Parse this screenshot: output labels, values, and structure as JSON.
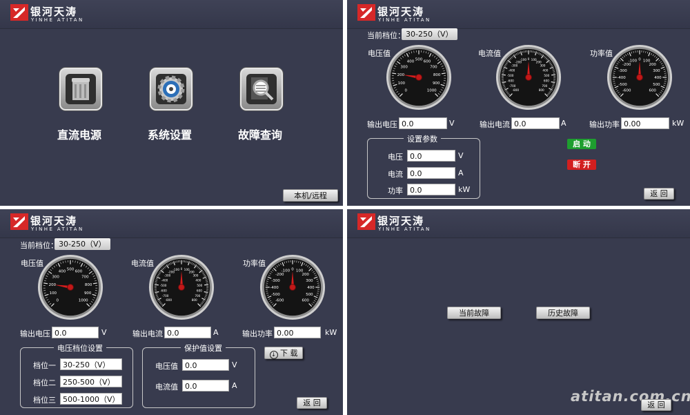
{
  "brand": {
    "name_cn": "银河天涛",
    "name_en": "YINHE ATITAN",
    "logo_color": "#d62828"
  },
  "colors": {
    "panel_bg": "#383b4e",
    "start_button": "#1e9e2f",
    "stop_button": "#d21f1f"
  },
  "menu": {
    "items": [
      {
        "label": "直流电源",
        "icon": "power-supply-icon"
      },
      {
        "label": "系统设置",
        "icon": "gear-icon"
      },
      {
        "label": "故障查询",
        "icon": "fault-search-icon"
      }
    ],
    "local_remote_label": "本机/远程"
  },
  "monitor": {
    "current_range_label": "当前档位：",
    "current_range_value": "30-250（V）",
    "voltage_gauge": {
      "title": "电压值",
      "ticks": [
        "0",
        "100",
        "200",
        "300",
        "400",
        "500",
        "600",
        "700",
        "800",
        "900",
        "1000"
      ],
      "value": 200
    },
    "current_gauge": {
      "title": "电流值",
      "ticks": [
        "-800",
        "-700",
        "-600",
        "-500",
        "-400",
        "-300",
        "-200",
        "-100",
        "0",
        "100",
        "200",
        "300",
        "400",
        "500",
        "600",
        "700",
        "800"
      ],
      "value": 0
    },
    "power_gauge": {
      "title": "功率值",
      "ticks": [
        "-600",
        "-500",
        "-400",
        "-300",
        "-200",
        "-100",
        "0",
        "100",
        "200",
        "300",
        "400",
        "500",
        "600"
      ],
      "value": 0
    },
    "output_voltage": {
      "label": "输出电压",
      "value": "0.0",
      "unit": "V"
    },
    "output_current": {
      "label": "输出电流",
      "value": "0.0",
      "unit": "A"
    },
    "output_power": {
      "label": "输出功率",
      "value": "0.00",
      "unit": "kW"
    },
    "settings": {
      "title": "设置参数",
      "voltage": {
        "label": "电压",
        "value": "0.0",
        "unit": "V"
      },
      "current": {
        "label": "电流",
        "value": "0.0",
        "unit": "A"
      },
      "power": {
        "label": "功率",
        "value": "0.0",
        "unit": "kW"
      }
    },
    "start_label": "启 动",
    "stop_label": "断 开",
    "back_label": "返 回"
  },
  "range_settings": {
    "current_range_label": "当前档位：",
    "current_range_value": "30-250（V）",
    "voltage_gauge_title": "电压值",
    "current_gauge_title": "电流值",
    "power_gauge_title": "功率值",
    "output_voltage": {
      "label": "输出电压",
      "value": "0.0",
      "unit": "V"
    },
    "output_current": {
      "label": "输出电流",
      "value": "0.0",
      "unit": "A"
    },
    "output_power": {
      "label": "输出功率",
      "value": "0.00",
      "unit": "kW"
    },
    "range_group": {
      "title": "电压档位设置",
      "items": [
        {
          "label": "档位一",
          "value": "30-250（V）"
        },
        {
          "label": "档位二",
          "value": "250-500（V）"
        },
        {
          "label": "档位三",
          "value": "500-1000（V）"
        }
      ]
    },
    "protect_group": {
      "title": "保护值设置",
      "voltage": {
        "label": "电压值",
        "value": "0.0",
        "unit": "V"
      },
      "current": {
        "label": "电流值",
        "value": "0.0",
        "unit": "A"
      }
    },
    "download_label": "下 载",
    "back_label": "返 回"
  },
  "fault": {
    "current_fault_label": "当前故障",
    "history_fault_label": "历史故障",
    "back_label": "返 回"
  },
  "watermark": "atitan.com.cn"
}
